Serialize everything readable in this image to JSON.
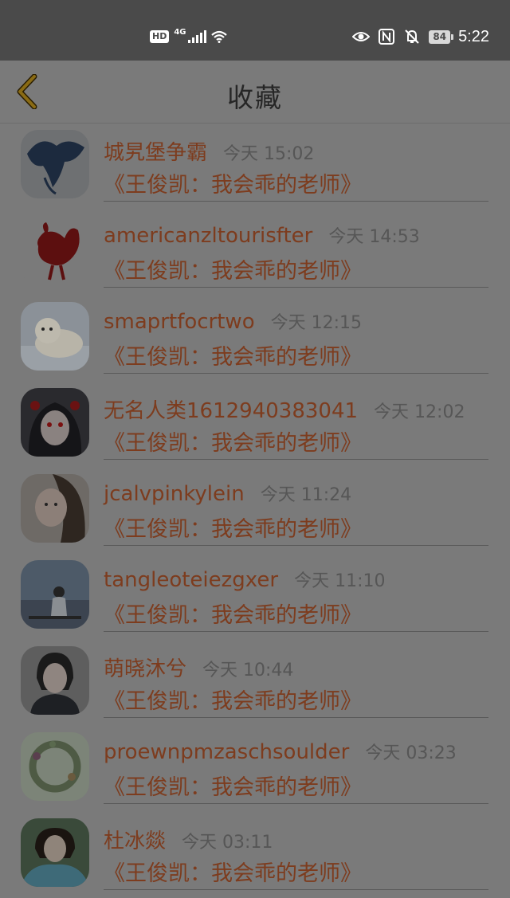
{
  "status_bar": {
    "hd_label": "HD",
    "network_label": "4G",
    "battery": "84",
    "time": "5:22"
  },
  "header": {
    "title": "收藏",
    "back_icon": "chevron-left-icon",
    "accent_color": "#8a6b14"
  },
  "favorites": [
    {
      "username": "城旯堡争霸",
      "time": "今天 15:02",
      "title": "《王俊凯：我会乖的老师》",
      "avatar": "abstract-blue-figure"
    },
    {
      "username": "americanzltourisfter",
      "time": "今天 14:53",
      "title": "《王俊凯：我会乖的老师》",
      "avatar": "red-rooster-papercut"
    },
    {
      "username": "smaprtfocrtwo",
      "time": "今天 12:15",
      "title": "《王俊凯：我会乖的老师》",
      "avatar": "white-seal-pup"
    },
    {
      "username": "无名人类1612940383041",
      "time": "今天 12:02",
      "title": "《王俊凯：我会乖的老师》",
      "avatar": "anime-girl"
    },
    {
      "username": "jcalvpinkylein",
      "time": "今天 11:24",
      "title": "《王俊凯：我会乖的老师》",
      "avatar": "woman-portrait"
    },
    {
      "username": "tangleoteiezgxer",
      "time": "今天 11:10",
      "title": "《王俊凯：我会乖的老师》",
      "avatar": "man-sitting-seaside"
    },
    {
      "username": "萌晓沐兮",
      "time": "今天 10:44",
      "title": "《王俊凯：我会乖的老师》",
      "avatar": "girl-portrait"
    },
    {
      "username": "proewnpmzaschsoulder",
      "time": "今天 03:23",
      "title": "《王俊凯：我会乖的老师》",
      "avatar": "flower-wreath"
    },
    {
      "username": "杜冰燚",
      "time": "今天 03:11",
      "title": "《王俊凯：我会乖的老师》",
      "avatar": "girl-in-flowers"
    }
  ]
}
